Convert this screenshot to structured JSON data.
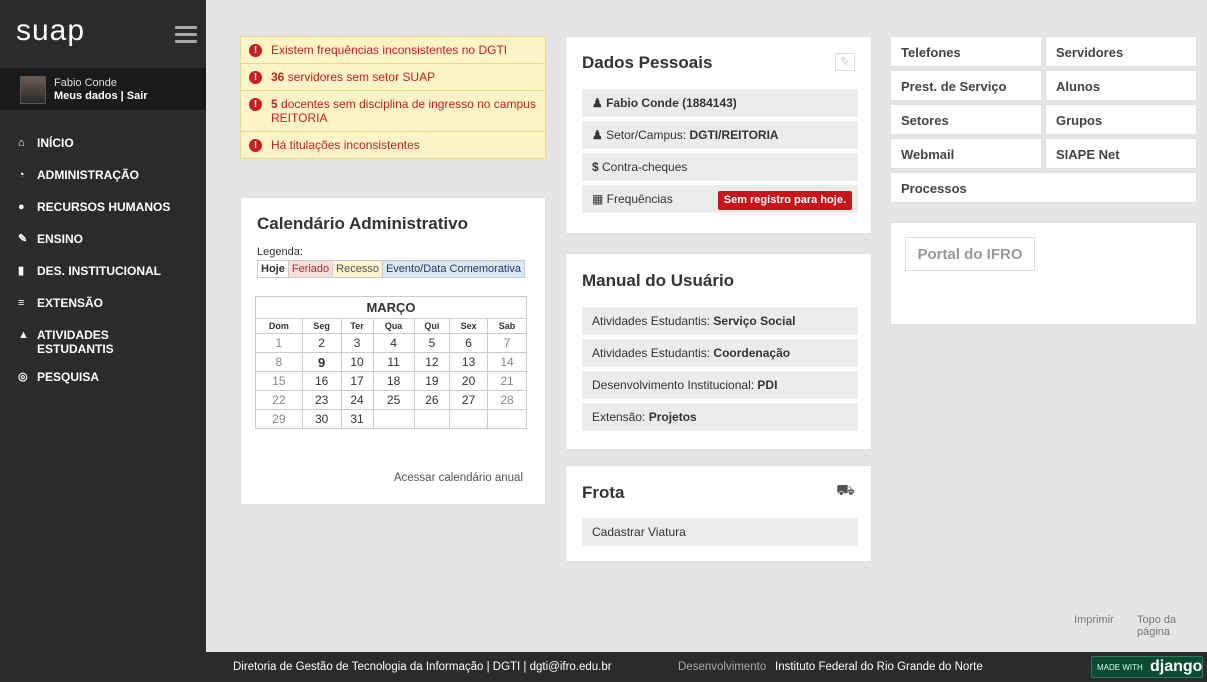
{
  "sidebar": {
    "logo": "suap",
    "user_name": "Fabio Conde",
    "user_links": "Meus dados | Sair",
    "menu": [
      {
        "icon": "home-icon",
        "glyph": "⌂",
        "label": "INÍCIO"
      },
      {
        "icon": "admin-icon",
        "glyph": "◔",
        "label": "ADMINISTRAÇÃO"
      },
      {
        "icon": "user-icon",
        "glyph": "●",
        "label": "RECURSOS HUMANOS"
      },
      {
        "icon": "pencil-icon",
        "glyph": "✎",
        "label": "ENSINO"
      },
      {
        "icon": "bar-chart-icon",
        "glyph": "▮",
        "label": "DES. INSTITUCIONAL"
      },
      {
        "icon": "extension-icon",
        "glyph": "≡",
        "label": "EXTENSÃO"
      },
      {
        "icon": "graduation-cap-icon",
        "glyph": "▲",
        "label": "ATIVIDADES ESTUDANTIS"
      },
      {
        "icon": "globe-icon",
        "glyph": "◎",
        "label": "PESQUISA"
      }
    ]
  },
  "alerts": [
    {
      "strong": "",
      "text": "Existem frequências inconsistentes no DGTI"
    },
    {
      "strong": "36",
      "text": " servidores sem setor SUAP"
    },
    {
      "strong": "5",
      "text": " docentes sem disciplina de ingresso no campus REITORIA"
    },
    {
      "strong": "",
      "text": "Há titulações inconsistentes"
    }
  ],
  "calendar": {
    "title": "Calendário Administrativo",
    "legend_label": "Legenda:",
    "legend": [
      "Hoje",
      "Feriado",
      "Recesso",
      "Evento/Data Comemorativa"
    ],
    "month": "MARÇO",
    "weekdays": [
      "Dom",
      "Seg",
      "Ter",
      "Qua",
      "Qui",
      "Sex",
      "Sab"
    ],
    "weeks": [
      [
        "1",
        "2",
        "3",
        "4",
        "5",
        "6",
        "7"
      ],
      [
        "8",
        "9",
        "10",
        "11",
        "12",
        "13",
        "14"
      ],
      [
        "15",
        "16",
        "17",
        "18",
        "19",
        "20",
        "21"
      ],
      [
        "22",
        "23",
        "24",
        "25",
        "26",
        "27",
        "28"
      ],
      [
        "29",
        "30",
        "31",
        "",
        "",
        "",
        ""
      ]
    ],
    "today": "9",
    "link": "Acessar calendário anual"
  },
  "dados": {
    "title": "Dados Pessoais",
    "name": "Fabio Conde (1884143)",
    "setor_label": "Setor/Campus: ",
    "setor_value": "DGTI/REITORIA",
    "contra": "Contra-cheques",
    "freq": "Frequências",
    "freq_badge": "Sem registro para hoje."
  },
  "manual": {
    "title": "Manual do Usuário",
    "items": [
      {
        "pre": "Atividades Estudantis: ",
        "strong": "Serviço Social"
      },
      {
        "pre": "Atividades Estudantis: ",
        "strong": "Coordenação"
      },
      {
        "pre": "Desenvolvimento Institucional: ",
        "strong": "PDI"
      },
      {
        "pre": "Extensão: ",
        "strong": "Projetos"
      }
    ]
  },
  "frota": {
    "title": "Frota",
    "item": "Cadastrar Viatura"
  },
  "links": [
    "Telefones",
    "Servidores",
    "Prest. de Serviço",
    "Alunos",
    "Setores",
    "Grupos",
    "Webmail",
    "SIAPE Net",
    "Processos"
  ],
  "portal": "Portal do IFRO",
  "page_links": {
    "print": "Imprimir",
    "top": "Topo da página"
  },
  "footer": {
    "left": "Diretoria de Gestão de Tecnologia da Informação | DGTI |  dgti@ifro.edu.br",
    "dev_label": "Desenvolvimento",
    "dev_value": "Instituto Federal do Rio Grande do Norte",
    "badge_small": "MADE WITH",
    "badge_big": "django"
  },
  "colors": {
    "sidebar": "#2b2b2b",
    "alert_bg": "#fcf3c8",
    "alert_text": "#c42222",
    "badge": "#c9141c",
    "django": "#0c4b33"
  }
}
